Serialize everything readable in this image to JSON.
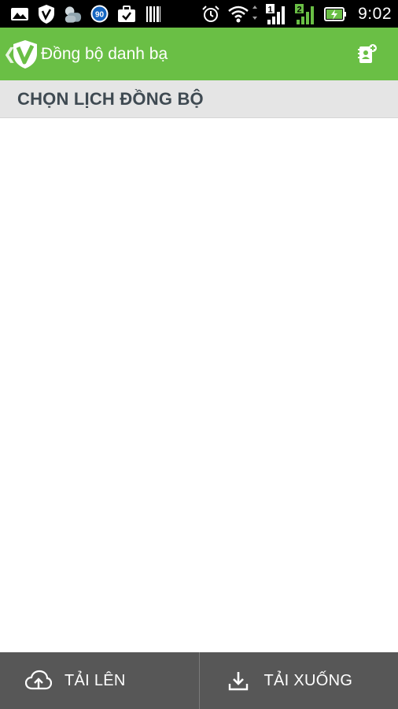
{
  "status_bar": {
    "time": "9:02",
    "battery_level": 0.7,
    "notification_badge": "90",
    "sim1_label": "1",
    "sim2_label": "2",
    "left_icons": [
      "picture-icon",
      "shield-icon",
      "weather-icon",
      "speed-badge-icon",
      "briefcase-check-icon",
      "barcode-icon"
    ],
    "right_icons": [
      "alarm-icon",
      "wifi-icon",
      "signal-sim1-icon",
      "signal-sim2-icon",
      "battery-charging-icon"
    ]
  },
  "app_bar": {
    "title": "Đồng bộ danh bạ",
    "color": "#6abf45",
    "action_icon": "contact-sync-icon"
  },
  "section": {
    "title": "CHỌN LỊCH ĐỒNG BỘ"
  },
  "bottom_bar": {
    "upload_label": "TẢI LÊN",
    "download_label": "TẢI XUỐNG",
    "upload_icon": "cloud-upload-icon",
    "download_icon": "download-icon"
  }
}
